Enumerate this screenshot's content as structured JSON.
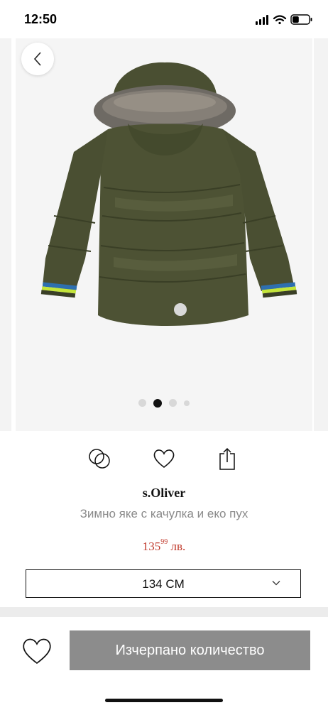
{
  "status_bar": {
    "time": "12:50",
    "battery_level": 0.4
  },
  "gallery": {
    "image_count": 4,
    "active_index": 1
  },
  "icons": {
    "back": "chevron-left-icon",
    "compare": "compare-rings-icon",
    "wishlist": "heart-icon",
    "share": "share-icon",
    "size_chevron": "chevron-down-icon"
  },
  "product": {
    "brand": "s.Oliver",
    "name": "Зимно яке с качулка и еко пух",
    "price_main": "135",
    "price_cents": "99",
    "price_currency": "лв."
  },
  "size_selector": {
    "selected": "134 CM"
  },
  "bottom_bar": {
    "cta_label": "Изчерпано количество"
  },
  "colors": {
    "price": "#c0392b",
    "cta_background": "#8c8c8c",
    "jacket": "#4a4f32"
  }
}
